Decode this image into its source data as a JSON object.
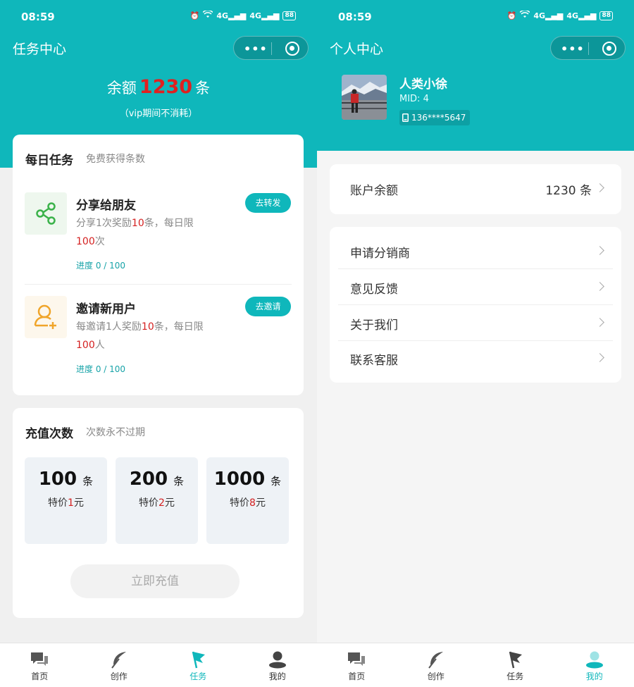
{
  "left": {
    "status": {
      "time": "08:59",
      "signal1": "4G",
      "signal2": "4G",
      "battery": "88"
    },
    "nav": {
      "title": "任务中心"
    },
    "balance": {
      "prefix": "余额",
      "value": "1230",
      "unit": "条",
      "note": "（vip期间不消耗）"
    },
    "daily": {
      "title": "每日任务",
      "subtitle": "免费获得条数",
      "tasks": [
        {
          "name": "分享给朋友",
          "desc_a": "分享1次奖励",
          "desc_n": "10",
          "desc_b": "条，每日限",
          "limit_n": "100",
          "limit_u": "次",
          "progress": "进度 0 / 100",
          "button": "去转发",
          "icon": "share-icon"
        },
        {
          "name": "邀请新用户",
          "desc_a": "每邀请1人奖励",
          "desc_n": "10",
          "desc_b": "条，每日限",
          "limit_n": "100",
          "limit_u": "人",
          "progress": "进度 0 / 100",
          "button": "去邀请",
          "icon": "add-user-icon"
        }
      ]
    },
    "recharge": {
      "title": "充值次数",
      "subtitle": "次数永不过期",
      "packages": [
        {
          "amount": "100",
          "unit": "条",
          "price_a": "特价",
          "price_n": "1",
          "price_b": "元"
        },
        {
          "amount": "200",
          "unit": "条",
          "price_a": "特价",
          "price_n": "2",
          "price_b": "元"
        },
        {
          "amount": "1000",
          "unit": "条",
          "price_a": "特价",
          "price_n": "8",
          "price_b": "元"
        }
      ],
      "button": "立即充值"
    },
    "tabbar": [
      {
        "label": "首页",
        "icon": "chat-icon"
      },
      {
        "label": "创作",
        "icon": "feather-icon"
      },
      {
        "label": "任务",
        "icon": "flag-icon"
      },
      {
        "label": "我的",
        "icon": "person-icon"
      }
    ],
    "active_tab": 2
  },
  "right": {
    "status": {
      "time": "08:59",
      "signal1": "4G",
      "signal2": "4G",
      "battery": "88"
    },
    "nav": {
      "title": "个人中心"
    },
    "user": {
      "name": "人类小徐",
      "mid": "MID: 4",
      "phone": "136****5647"
    },
    "account": {
      "label": "账户余额",
      "value": "1230 条"
    },
    "menu": [
      {
        "label": "申请分销商"
      },
      {
        "label": "意见反馈"
      },
      {
        "label": "关于我们"
      },
      {
        "label": "联系客服"
      }
    ],
    "tabbar": [
      {
        "label": "首页",
        "icon": "chat-icon"
      },
      {
        "label": "创作",
        "icon": "feather-icon"
      },
      {
        "label": "任务",
        "icon": "flag-icon"
      },
      {
        "label": "我的",
        "icon": "person-icon"
      }
    ],
    "active_tab": 3
  },
  "colors": {
    "primary": "#0fb7bb",
    "accent_red": "#d42020"
  }
}
